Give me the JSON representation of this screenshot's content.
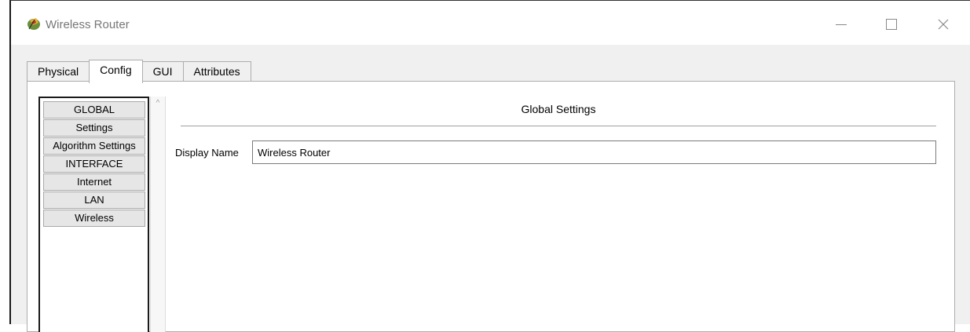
{
  "window": {
    "title": "Wireless Router",
    "controls": {
      "minimize": "—",
      "maximize": "☐",
      "close": "✕"
    }
  },
  "tabs": [
    {
      "label": "Physical",
      "active": false
    },
    {
      "label": "Config",
      "active": true
    },
    {
      "label": "GUI",
      "active": false
    },
    {
      "label": "Attributes",
      "active": false
    }
  ],
  "sidebar": {
    "items": [
      {
        "label": "GLOBAL"
      },
      {
        "label": "Settings"
      },
      {
        "label": "Algorithm Settings"
      },
      {
        "label": "INTERFACE"
      },
      {
        "label": "Internet"
      },
      {
        "label": "LAN"
      },
      {
        "label": "Wireless"
      }
    ]
  },
  "main": {
    "section_title": "Global Settings",
    "display_name_label": "Display Name",
    "display_name_value": "Wireless Router"
  },
  "colors": {
    "window_bg": "#f0f0f0",
    "panel_bg": "#ffffff",
    "nav_item_bg": "#e6e6e6"
  }
}
